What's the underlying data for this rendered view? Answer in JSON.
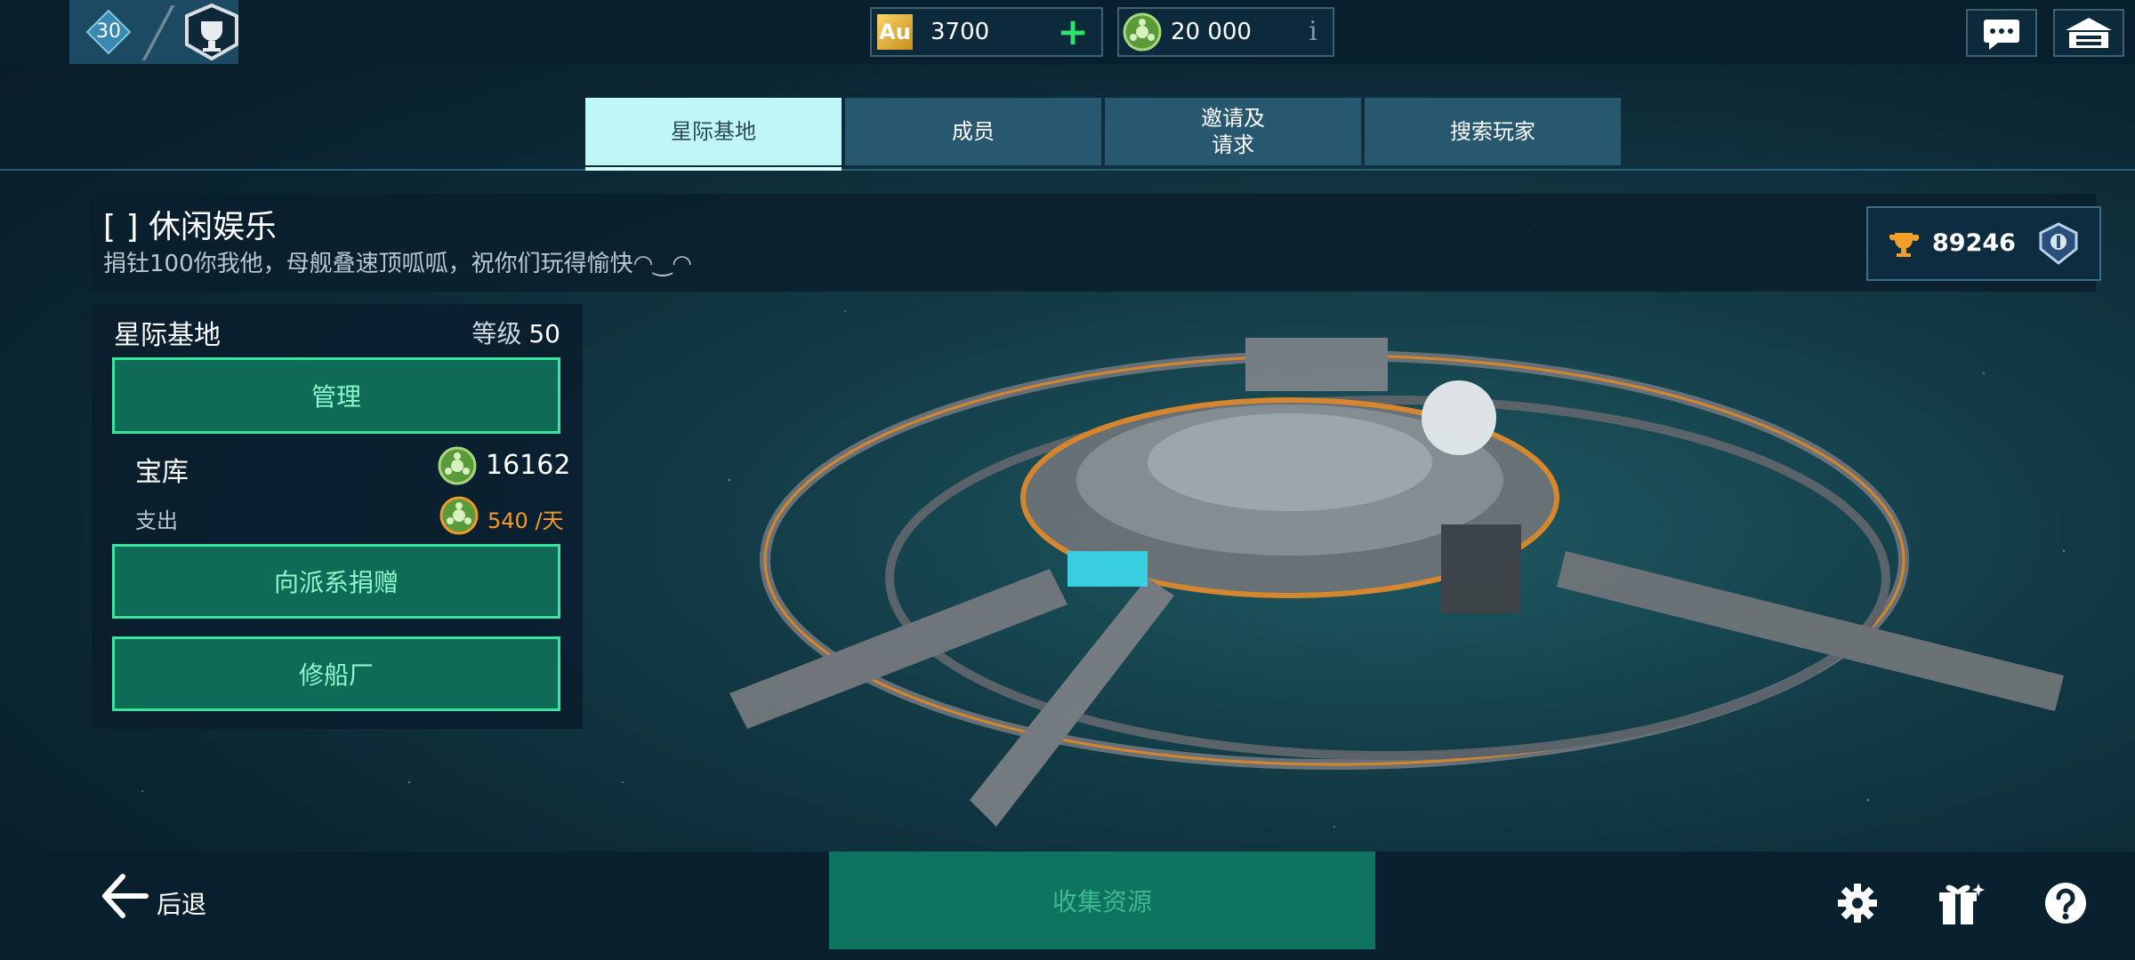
{
  "topbar": {
    "player_level": "30",
    "gold_amount": "3700",
    "gold_label": "Au",
    "credits_amount": "20 000",
    "info_label": "i"
  },
  "tabs": [
    {
      "label": "星际基地",
      "active": true
    },
    {
      "label": "成员",
      "active": false
    },
    {
      "label": "邀请及\n请求",
      "active": false
    },
    {
      "label": "搜索玩家",
      "active": false
    }
  ],
  "guild": {
    "title": "[    ] 休闲娱乐",
    "description": "捐钍100你我他，母舰叠速顶呱呱，祝你们玩得愉快◠‿◠",
    "trophies": "89246"
  },
  "panel": {
    "title": "星际基地",
    "level_label": "等级",
    "level_value": "50",
    "manage_button": "管理",
    "vault_label": "宝库",
    "vault_value": "16162",
    "spend_label": "支出",
    "spend_value": "540 /天",
    "donate_button": "向派系捐赠",
    "shipyard_button": "修船厂"
  },
  "bottom": {
    "back_label": "后退",
    "collect_button": "收集资源"
  },
  "colors": {
    "accent_green": "#39e3a0",
    "active_tab": "#bff7f7",
    "spend_orange": "#f19a2b"
  }
}
